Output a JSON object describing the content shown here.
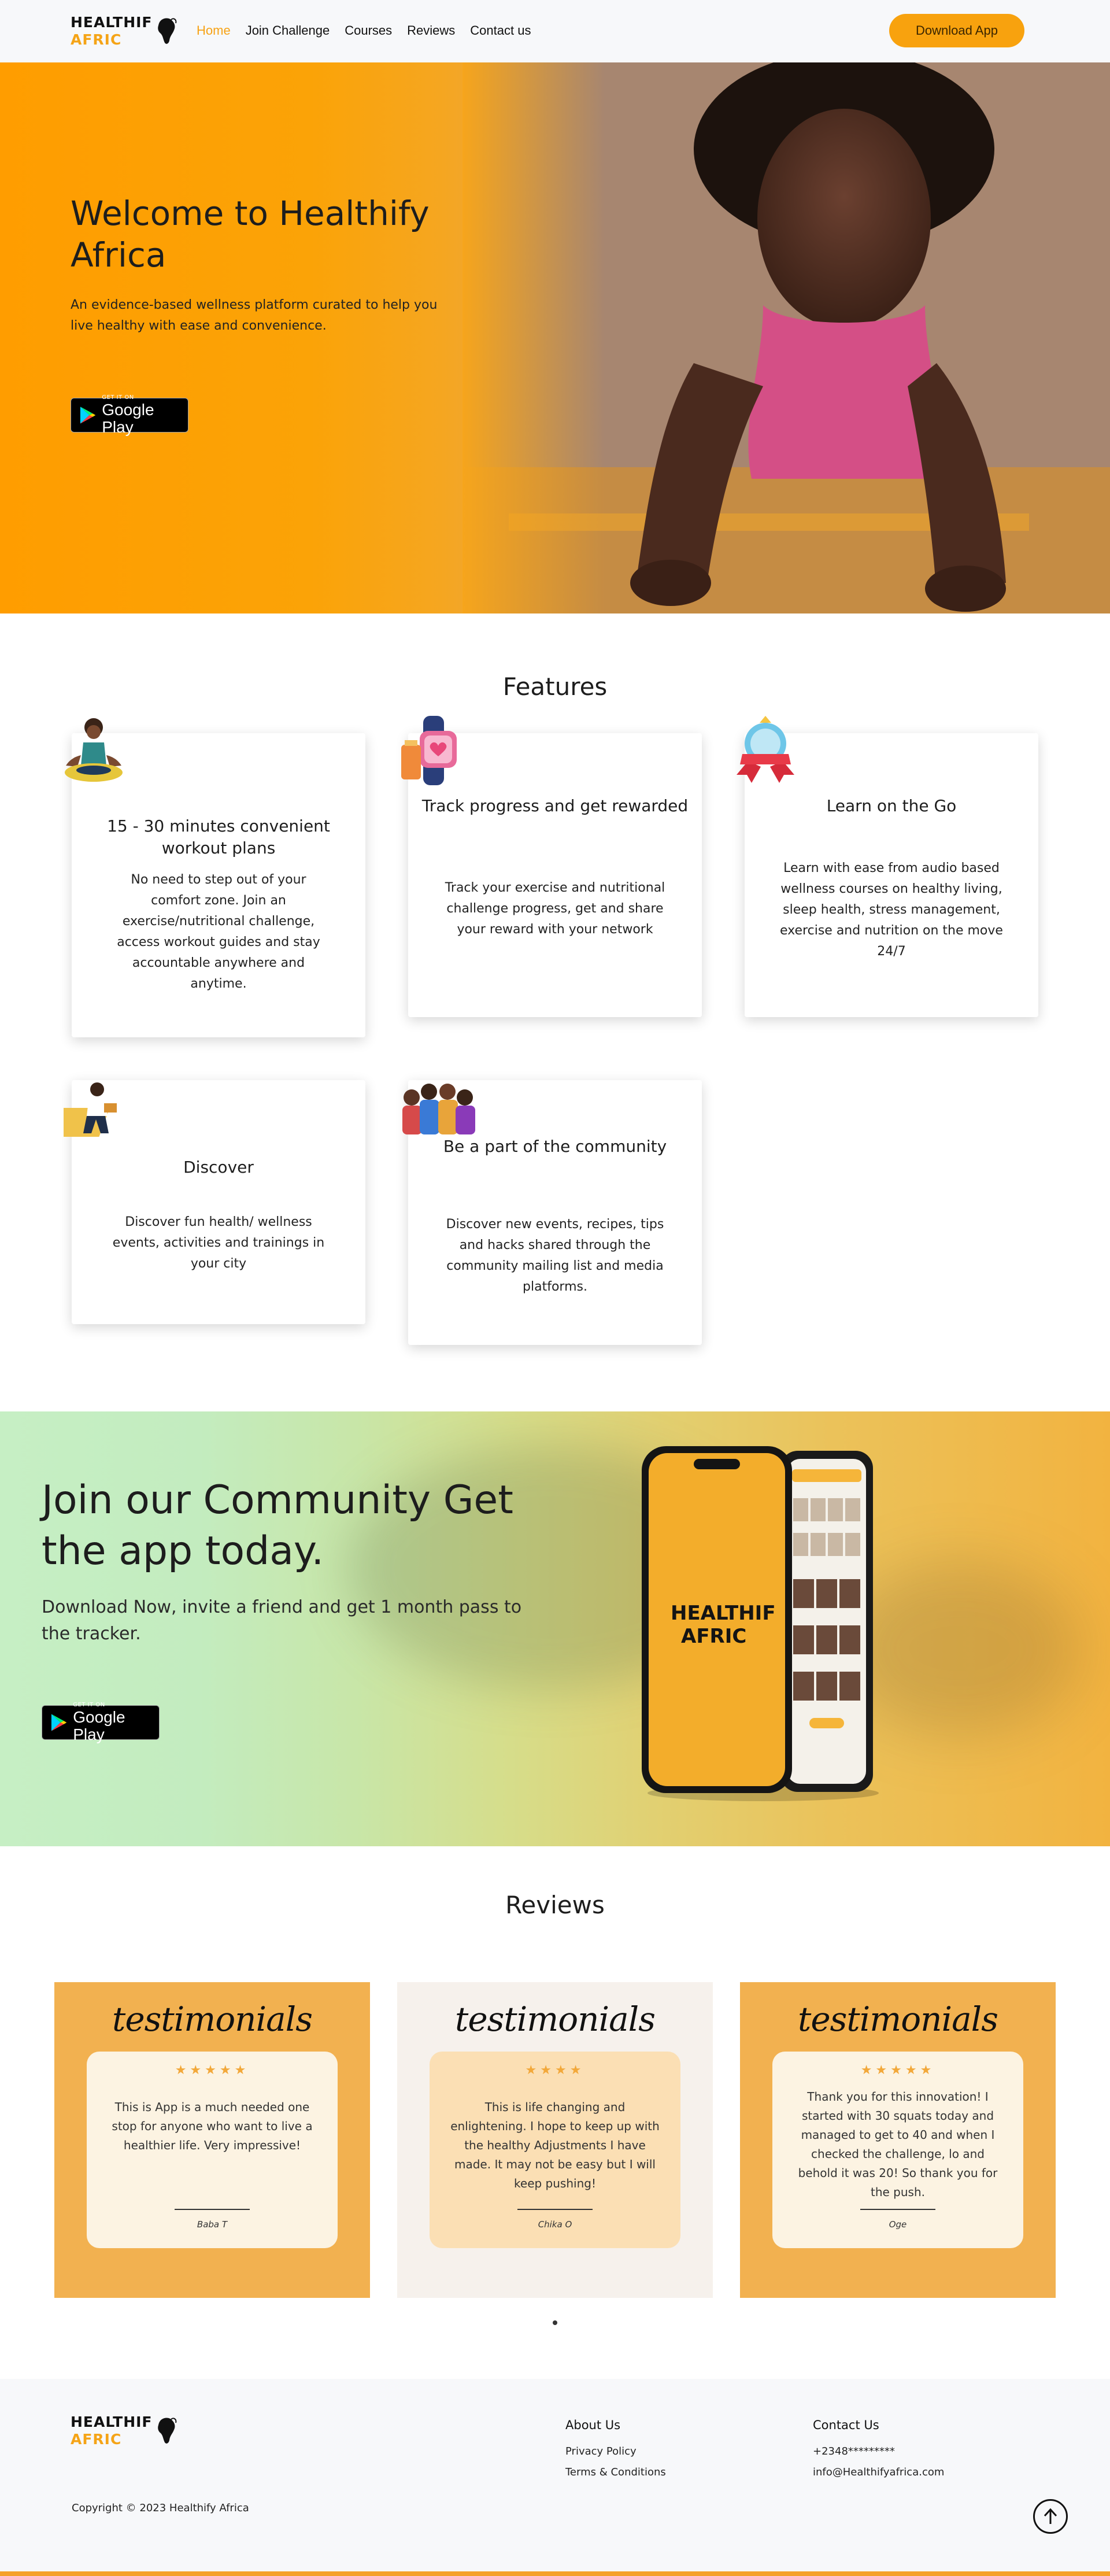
{
  "brand": {
    "line1": "HEALTHIF",
    "line2": "AFRIC",
    "accent": "#f8a20e"
  },
  "nav": {
    "links": [
      "Home",
      "Join Challenge",
      "Courses",
      "Reviews",
      "Contact us"
    ],
    "active": "Home",
    "download_label": "Download App"
  },
  "hero": {
    "title": "Welcome to Healthify Africa",
    "subtitle": "An evidence-based wellness platform curated to help you live healthy with ease and convenience.",
    "badge_small": "GET IT ON",
    "badge_big": "Google Play"
  },
  "features": {
    "title": "Features",
    "cards": [
      {
        "title": "15 - 30 minutes convenient workout plans",
        "text": "No need to step out of your comfort zone. Join an exercise/nutritional challenge, access workout guides and stay accountable anywhere and anytime.",
        "icon": "meditation-icon"
      },
      {
        "title": "Track progress and get rewarded",
        "text": "Track your exercise and nutritional challenge progress, get and share your reward with your network",
        "icon": "smartwatch-icon"
      },
      {
        "title": "Learn on the Go",
        "text": "Learn with ease from audio based wellness courses on healthy living, sleep health, stress management, exercise and nutrition on the move 24/7",
        "icon": "award-badge-icon"
      },
      {
        "title": "Discover",
        "text": "Discover fun health/ wellness events, activities and trainings in your city",
        "icon": "explorer-icon"
      },
      {
        "title": "Be a part of the community",
        "text": "Discover new events, recipes, tips and hacks shared through the community mailing list and media platforms.",
        "icon": "community-icon"
      }
    ]
  },
  "community": {
    "title": "Join our Community Get the app today.",
    "subtitle": "Download Now, invite a friend and get 1 month pass to the tracker.",
    "phone_brand_l1": "HEALTHIF",
    "phone_brand_l2": "AFRIC"
  },
  "reviews": {
    "title": "Reviews",
    "heading": "testimonials",
    "items": [
      {
        "stars": 5,
        "stars_text": "★★★★★",
        "text": "This is App is a much needed one stop for anyone who want to live a healthier life. Very impressive!",
        "name": "Baba T"
      },
      {
        "stars": 4,
        "stars_text": "★★★★",
        "text": "This is life changing and enlightening. I hope to keep up with the healthy Adjustments I have made. It may not be easy but I will keep pushing!",
        "name": "Chika O"
      },
      {
        "stars": 5,
        "stars_text": "★★★★★",
        "text": "Thank you for this innovation! I started with 30 squats today and managed to get to 40 and when I checked the challenge, lo and behold it was 20! So thank you for the push.",
        "name": "Oge"
      }
    ]
  },
  "footer": {
    "copyright": "Copyright © 2023 Healthify Africa",
    "about_title": "About Us",
    "about_links": [
      "Privacy Policy",
      "Terms & Conditions"
    ],
    "contact_title": "Contact Us",
    "phone": "+2348*********",
    "email": "info@Healthifyafrica.com"
  }
}
